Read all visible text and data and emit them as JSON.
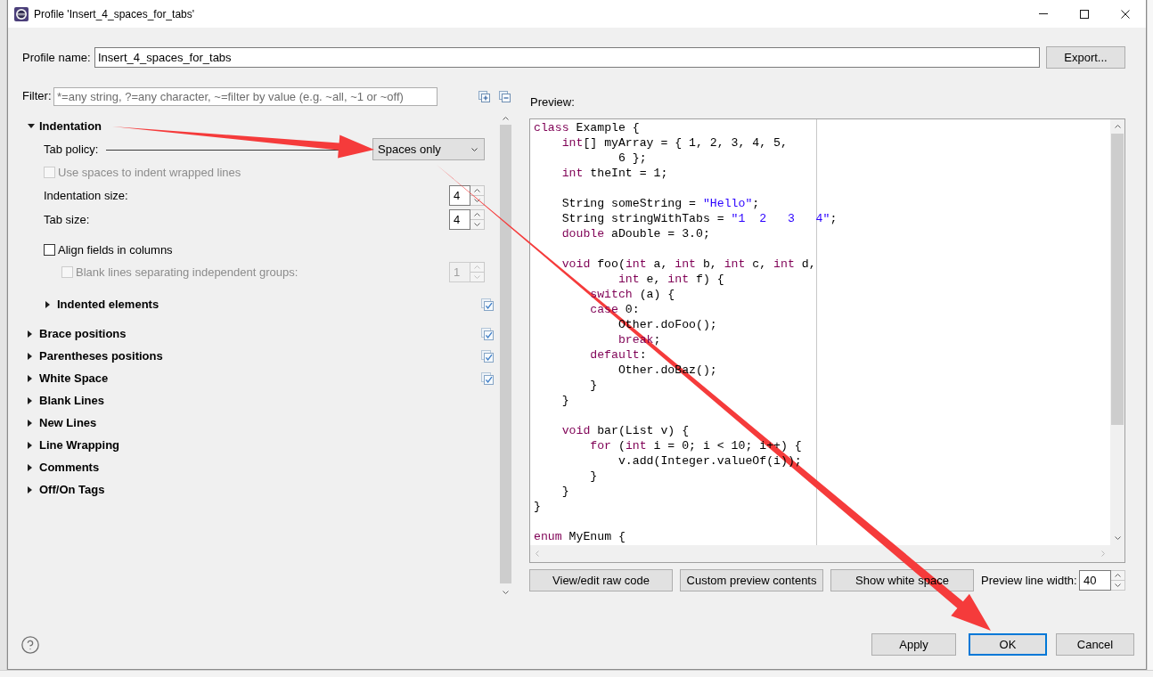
{
  "window": {
    "title": "Profile 'Insert_4_spaces_for_tabs'"
  },
  "profile": {
    "label": "Profile name:",
    "value": "Insert_4_spaces_for_tabs",
    "button": "Export..."
  },
  "filter": {
    "label": "Filter:",
    "placeholder": "*=any string, ?=any character, ~=filter by value (e.g. ~all, ~1 or ~off)"
  },
  "tree": [
    {
      "kind": "section",
      "label": "Indentation",
      "expanded": true,
      "modified": false,
      "children": [
        {
          "kind": "combo",
          "label": "Tab policy:",
          "value": "Spaces only"
        },
        {
          "kind": "checkbox",
          "label": "Use spaces to indent wrapped lines",
          "checked": false,
          "disabled": true
        },
        {
          "kind": "spinner",
          "label": "Indentation size:",
          "value": "4",
          "disabled": false
        },
        {
          "kind": "spinner",
          "label": "Tab size:",
          "value": "4",
          "disabled": false
        },
        {
          "kind": "checkbox",
          "label": "Align fields in columns",
          "checked": false,
          "disabled": false,
          "children": [
            {
              "kind": "checkbox_spinner",
              "label": "Blank lines separating independent groups:",
              "checked": false,
              "disabled": true,
              "value": "1"
            }
          ]
        },
        {
          "kind": "section",
          "label": "Indented elements",
          "expanded": false,
          "modified": true
        }
      ]
    },
    {
      "kind": "section",
      "label": "Brace positions",
      "expanded": false,
      "modified": true
    },
    {
      "kind": "section",
      "label": "Parentheses positions",
      "expanded": false,
      "modified": true
    },
    {
      "kind": "section",
      "label": "White Space",
      "expanded": false,
      "modified": true
    },
    {
      "kind": "section",
      "label": "Blank Lines",
      "expanded": false,
      "modified": false
    },
    {
      "kind": "section",
      "label": "New Lines",
      "expanded": false,
      "modified": false
    },
    {
      "kind": "section",
      "label": "Line Wrapping",
      "expanded": false,
      "modified": false
    },
    {
      "kind": "section",
      "label": "Comments",
      "expanded": false,
      "modified": false
    },
    {
      "kind": "section",
      "label": "Off/On Tags",
      "expanded": false,
      "modified": false
    }
  ],
  "preview": {
    "label": "Preview:",
    "code_blocks": [
      {
        "lines": [
          [
            {
              "kind": "keyword",
              "text": "class"
            },
            {
              "kind": "plain",
              "text": " Example {"
            }
          ],
          [
            {
              "kind": "keyword",
              "text": "    int"
            },
            {
              "kind": "plain",
              "text": "[] myArray = { 1, 2, 3, 4, 5,"
            }
          ],
          [
            {
              "kind": "plain",
              "text": "            6 };"
            }
          ],
          [
            {
              "kind": "keyword",
              "text": "    int"
            },
            {
              "kind": "plain",
              "text": " theInt = 1;"
            }
          ]
        ]
      },
      {
        "lines": [
          [
            {
              "kind": "plain",
              "text": "    String someString = "
            },
            {
              "kind": "string",
              "text": "\"Hello\""
            },
            {
              "kind": "plain",
              "text": ";"
            }
          ],
          [
            {
              "kind": "plain",
              "text": "    String stringWithTabs = "
            },
            {
              "kind": "string",
              "text": "\"1\t2\t3\t4\""
            },
            {
              "kind": "plain",
              "text": ";"
            }
          ],
          [
            {
              "kind": "keyword",
              "text": "    double"
            },
            {
              "kind": "plain",
              "text": " aDouble = 3.0;"
            }
          ]
        ]
      },
      {
        "lines": [
          [
            {
              "kind": "keyword",
              "text": "    void"
            },
            {
              "kind": "plain",
              "text": " foo("
            },
            {
              "kind": "keyword",
              "text": "int"
            },
            {
              "kind": "plain",
              "text": " a, "
            },
            {
              "kind": "keyword",
              "text": "int"
            },
            {
              "kind": "plain",
              "text": " b, "
            },
            {
              "kind": "keyword",
              "text": "int"
            },
            {
              "kind": "plain",
              "text": " c, "
            },
            {
              "kind": "keyword",
              "text": "int"
            },
            {
              "kind": "plain",
              "text": " d,"
            }
          ],
          [
            {
              "kind": "keyword",
              "text": "            int"
            },
            {
              "kind": "plain",
              "text": " e, "
            },
            {
              "kind": "keyword",
              "text": "int"
            },
            {
              "kind": "plain",
              "text": " f) {"
            }
          ],
          [
            {
              "kind": "keyword",
              "text": "        switch"
            },
            {
              "kind": "plain",
              "text": " (a) {"
            }
          ],
          [
            {
              "kind": "keyword",
              "text": "        case"
            },
            {
              "kind": "plain",
              "text": " 0:"
            }
          ],
          [
            {
              "kind": "plain",
              "text": "            Other.doFoo();"
            }
          ],
          [
            {
              "kind": "keyword",
              "text": "            break"
            },
            {
              "kind": "plain",
              "text": ";"
            }
          ],
          [
            {
              "kind": "keyword",
              "text": "        default"
            },
            {
              "kind": "plain",
              "text": ":"
            }
          ],
          [
            {
              "kind": "plain",
              "text": "            Other.doBaz();"
            }
          ],
          [
            {
              "kind": "plain",
              "text": "        }"
            }
          ],
          [
            {
              "kind": "plain",
              "text": "    }"
            }
          ]
        ]
      },
      {
        "lines": [
          [
            {
              "kind": "keyword",
              "text": "    void"
            },
            {
              "kind": "plain",
              "text": " bar(List v) {"
            }
          ],
          [
            {
              "kind": "keyword",
              "text": "        for"
            },
            {
              "kind": "plain",
              "text": " ("
            },
            {
              "kind": "keyword",
              "text": "int"
            },
            {
              "kind": "plain",
              "text": " i = 0; i < 10; i++) {"
            }
          ],
          [
            {
              "kind": "plain",
              "text": "            v.add(Integer.valueOf(i));"
            }
          ],
          [
            {
              "kind": "plain",
              "text": "        }"
            }
          ],
          [
            {
              "kind": "plain",
              "text": "    }"
            }
          ],
          [
            {
              "kind": "plain",
              "text": "}"
            }
          ]
        ]
      },
      {
        "lines": [
          [
            {
              "kind": "keyword",
              "text": "enum"
            },
            {
              "kind": "plain",
              "text": " MyEnum {"
            }
          ]
        ]
      }
    ],
    "buttons": [
      "View/edit raw code",
      "Custom preview contents",
      "Show white space"
    ],
    "line_width": {
      "label": "Preview line width:",
      "value": "40"
    }
  },
  "footer": {
    "buttons": [
      {
        "label": "Apply",
        "default": false
      },
      {
        "label": "OK",
        "default": true
      },
      {
        "label": "Cancel",
        "default": false
      }
    ]
  }
}
